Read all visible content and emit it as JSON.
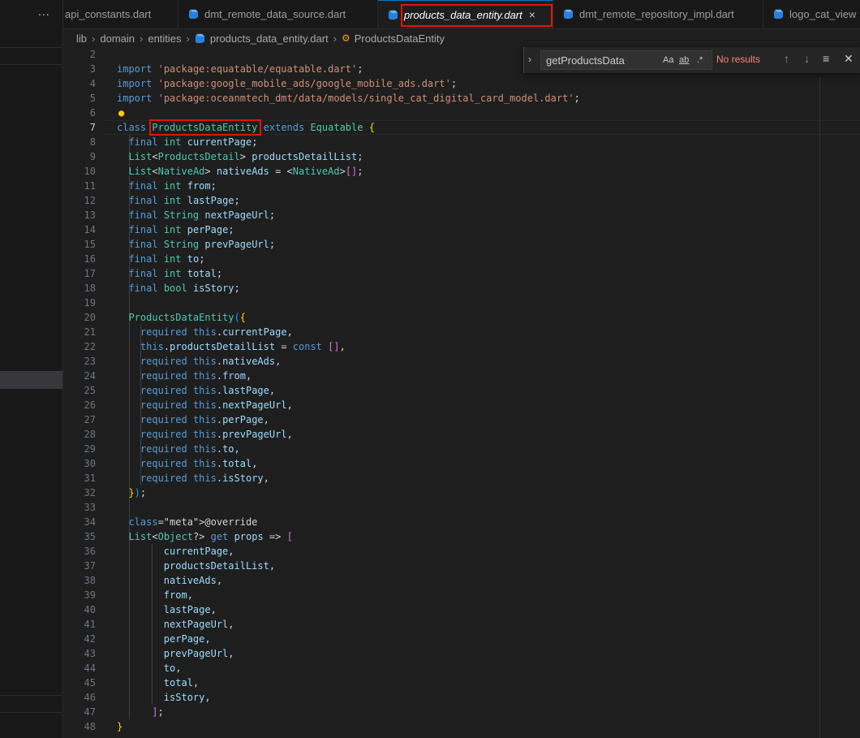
{
  "tabs": {
    "overflow": "...",
    "items": [
      {
        "label": "api_constants.dart"
      },
      {
        "label": "dmt_remote_data_source.dart"
      },
      {
        "label": "products_data_entity.dart",
        "close": "×"
      },
      {
        "label": "dmt_remote_repository_impl.dart"
      },
      {
        "label": "logo_cat_view"
      }
    ]
  },
  "breadcrumb": {
    "parts": [
      "lib",
      "domain",
      "entities",
      "products_data_entity.dart",
      "ProductsDataEntity"
    ]
  },
  "find": {
    "query": "getProductsData",
    "match_case": "Aa",
    "whole_word": "ab",
    "regex": ".*",
    "status": "No results"
  },
  "colors": {
    "highlight_box": "#e51400",
    "active_tab_accent": "#0078d4",
    "keyword": "#569cd6",
    "type": "#4ec9b0",
    "string": "#ce9178"
  },
  "code": {
    "lines": [
      {
        "n": "2",
        "t": ""
      },
      {
        "n": "3",
        "t": "import 'package:equatable/equatable.dart';"
      },
      {
        "n": "4",
        "t": "import 'package:google_mobile_ads/google_mobile_ads.dart';"
      },
      {
        "n": "5",
        "t": "import 'package:oceanmtech_dmt/data/models/single_cat_digital_card_model.dart';"
      },
      {
        "n": "6",
        "t": ""
      },
      {
        "n": "7",
        "t": "class ProductsDataEntity extends Equatable {"
      },
      {
        "n": "8",
        "t": "  final int currentPage;"
      },
      {
        "n": "9",
        "t": "  List<ProductsDetail> productsDetailList;"
      },
      {
        "n": "10",
        "t": "  List<NativeAd> nativeAds = <NativeAd>[];"
      },
      {
        "n": "11",
        "t": "  final int from;"
      },
      {
        "n": "12",
        "t": "  final int lastPage;"
      },
      {
        "n": "13",
        "t": "  final String nextPageUrl;"
      },
      {
        "n": "14",
        "t": "  final int perPage;"
      },
      {
        "n": "15",
        "t": "  final String prevPageUrl;"
      },
      {
        "n": "16",
        "t": "  final int to;"
      },
      {
        "n": "17",
        "t": "  final int total;"
      },
      {
        "n": "18",
        "t": "  final bool isStory;"
      },
      {
        "n": "19",
        "t": ""
      },
      {
        "n": "20",
        "t": "  ProductsDataEntity({"
      },
      {
        "n": "21",
        "t": "    required this.currentPage,"
      },
      {
        "n": "22",
        "t": "    this.productsDetailList = const [],"
      },
      {
        "n": "23",
        "t": "    required this.nativeAds,"
      },
      {
        "n": "24",
        "t": "    required this.from,"
      },
      {
        "n": "25",
        "t": "    required this.lastPage,"
      },
      {
        "n": "26",
        "t": "    required this.nextPageUrl,"
      },
      {
        "n": "27",
        "t": "    required this.perPage,"
      },
      {
        "n": "28",
        "t": "    required this.prevPageUrl,"
      },
      {
        "n": "29",
        "t": "    required this.to,"
      },
      {
        "n": "30",
        "t": "    required this.total,"
      },
      {
        "n": "31",
        "t": "    required this.isStory,"
      },
      {
        "n": "32",
        "t": "  });"
      },
      {
        "n": "33",
        "t": ""
      },
      {
        "n": "34",
        "t": "  @override"
      },
      {
        "n": "35",
        "t": "  List<Object?> get props => ["
      },
      {
        "n": "36",
        "t": "        currentPage,"
      },
      {
        "n": "37",
        "t": "        productsDetailList,"
      },
      {
        "n": "38",
        "t": "        nativeAds,"
      },
      {
        "n": "39",
        "t": "        from,"
      },
      {
        "n": "40",
        "t": "        lastPage,"
      },
      {
        "n": "41",
        "t": "        nextPageUrl,"
      },
      {
        "n": "42",
        "t": "        perPage,"
      },
      {
        "n": "43",
        "t": "        prevPageUrl,"
      },
      {
        "n": "44",
        "t": "        to,"
      },
      {
        "n": "45",
        "t": "        total,"
      },
      {
        "n": "46",
        "t": "        isStory,"
      },
      {
        "n": "47",
        "t": "      ];"
      },
      {
        "n": "48",
        "t": "}"
      }
    ]
  }
}
